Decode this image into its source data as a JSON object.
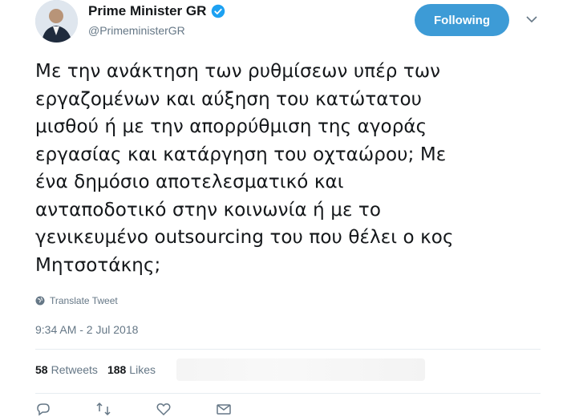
{
  "header": {
    "display_name": "Prime Minister GR",
    "handle": "@PrimeministerGR",
    "follow_label": "Following"
  },
  "tweet": {
    "text": "Με την ανάκτηση των ρυθμίσεων υπέρ των\nεργαζομένων και αύξηση του κατώτατου\nμισθού ή με την απορρύθμιση της αγοράς\nεργασίας και κατάργηση του οχταώρου; Με\nένα δημόσιο αποτελεσματικό και\nανταποδοτικό στην κοινωνία ή με το\nγενικευμένο outsourcing του που θέλει ο κος\nΜητσοτάκης;",
    "translate_label": "Translate Tweet",
    "timestamp": "9:34 AM - 2 Jul 2018"
  },
  "stats": {
    "retweets_count": "58",
    "retweets_label": "Retweets",
    "likes_count": "188",
    "likes_label": "Likes"
  },
  "colors": {
    "accent": "#3d9bd6",
    "verified": "#1da1f2",
    "muted": "#657786"
  },
  "icons": [
    "verified-badge-icon",
    "chevron-down-icon",
    "globe-icon",
    "reply-icon",
    "retweet-icon",
    "like-icon",
    "message-icon"
  ]
}
